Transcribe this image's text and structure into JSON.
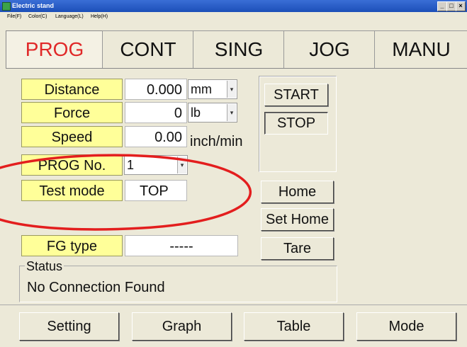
{
  "window": {
    "title": "Electric stand",
    "controls": [
      "_",
      "□",
      "×"
    ]
  },
  "menubar": {
    "items": [
      "File(F)",
      "Color(C)",
      "Language(L)",
      "Help(H)"
    ]
  },
  "tabs": [
    {
      "label": "PROG",
      "active": true
    },
    {
      "label": "CONT",
      "active": false
    },
    {
      "label": "SING",
      "active": false
    },
    {
      "label": "JOG",
      "active": false
    },
    {
      "label": "MANU",
      "active": false
    }
  ],
  "fields": {
    "distance": {
      "label": "Distance",
      "value": "0.000",
      "unit": "mm"
    },
    "force": {
      "label": "Force",
      "value": "0",
      "unit": "lb"
    },
    "speed": {
      "label": "Speed",
      "value": "0.00",
      "unit": "inch/min"
    },
    "prog_no": {
      "label": "PROG No.",
      "value": "1"
    },
    "test_mode": {
      "label": "Test mode",
      "value": "TOP"
    },
    "fg_type": {
      "label": "FG type",
      "value": "-----"
    }
  },
  "buttons": {
    "start": "START",
    "stop": "STOP",
    "home": "Home",
    "set_home": "Set Home",
    "tare": "Tare"
  },
  "status": {
    "title": "Status",
    "text": "No Connection Found"
  },
  "bottom_buttons": [
    "Setting",
    "Graph",
    "Table",
    "Mode"
  ],
  "colors": {
    "label_bg": "#ffff99",
    "active_tab": "#e02828",
    "annotation": "#e31e1e"
  },
  "icons": {
    "app": "electric-stand-app-icon",
    "dropdown": "chevron-down-icon"
  }
}
